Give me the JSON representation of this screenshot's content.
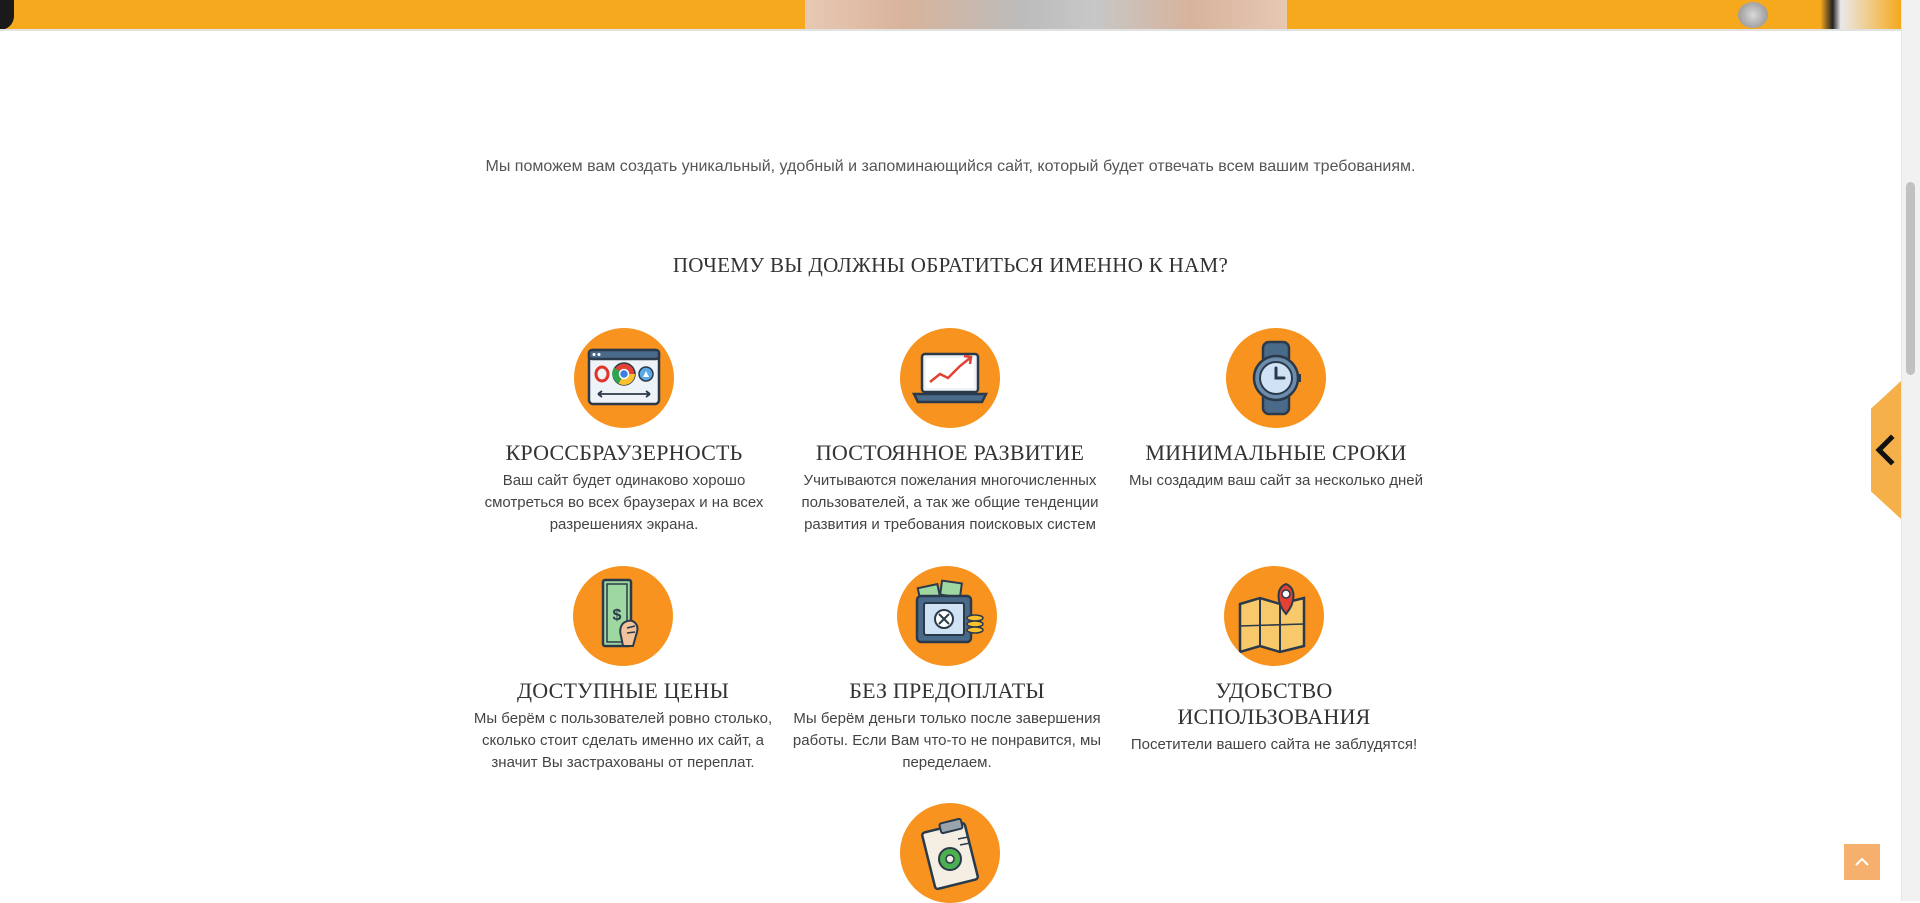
{
  "intro": {
    "text": "Мы поможем вам создать уникальный, удобный и запоминающийся сайт, который будет отвечать всем вашим требованиям."
  },
  "section": {
    "title": "ПОЧЕМУ ВЫ ДОЛЖНЫ ОБРАТИТЬСЯ ИМЕННО К НАМ?"
  },
  "features": [
    {
      "icon": "browsers-icon",
      "title": "КРОССБРАУЗЕРНОСТЬ",
      "text": "Ваш сайт будет одинаково хорошо смотреться во всех браузерах и на всех разрешениях экрана."
    },
    {
      "icon": "growth-laptop-icon",
      "title": "ПОСТОЯННОЕ РАЗВИТИЕ",
      "text": "Учитываются пожелания многочисленных пользователей, а так же общие тенденции развития и требования поисковых систем"
    },
    {
      "icon": "watch-icon",
      "title": "МИНИМАЛЬНЫЕ СРОКИ",
      "text": "Мы создадим ваш сайт за несколько дней"
    },
    {
      "icon": "money-hand-icon",
      "title": "ДОСТУПНЫЕ ЦЕНЫ",
      "text": "Мы берём с пользователей ровно столько, сколько стоит сделать именно их сайт, а значит Вы застрахованы от переплат."
    },
    {
      "icon": "safe-icon",
      "title": "БЕЗ ПРЕДОПЛАТЫ",
      "text": "Мы берём деньги только после завершения работы. Если Вам что-то не понравится, мы переделаем."
    },
    {
      "icon": "map-pin-icon",
      "title": "УДОБСТВО ИСПОЛЬЗОВАНИЯ",
      "text": "Посетители вашего сайта не заблудятся!"
    },
    {
      "icon": "clipboard-gear-icon"
    }
  ],
  "colors": {
    "accent": "#f7931e",
    "side_tab": "#f6b049",
    "to_top": "#f6b06d"
  },
  "controls": {
    "side_tab_icon": "chevron-left-icon",
    "to_top_icon": "chevron-up-icon"
  }
}
